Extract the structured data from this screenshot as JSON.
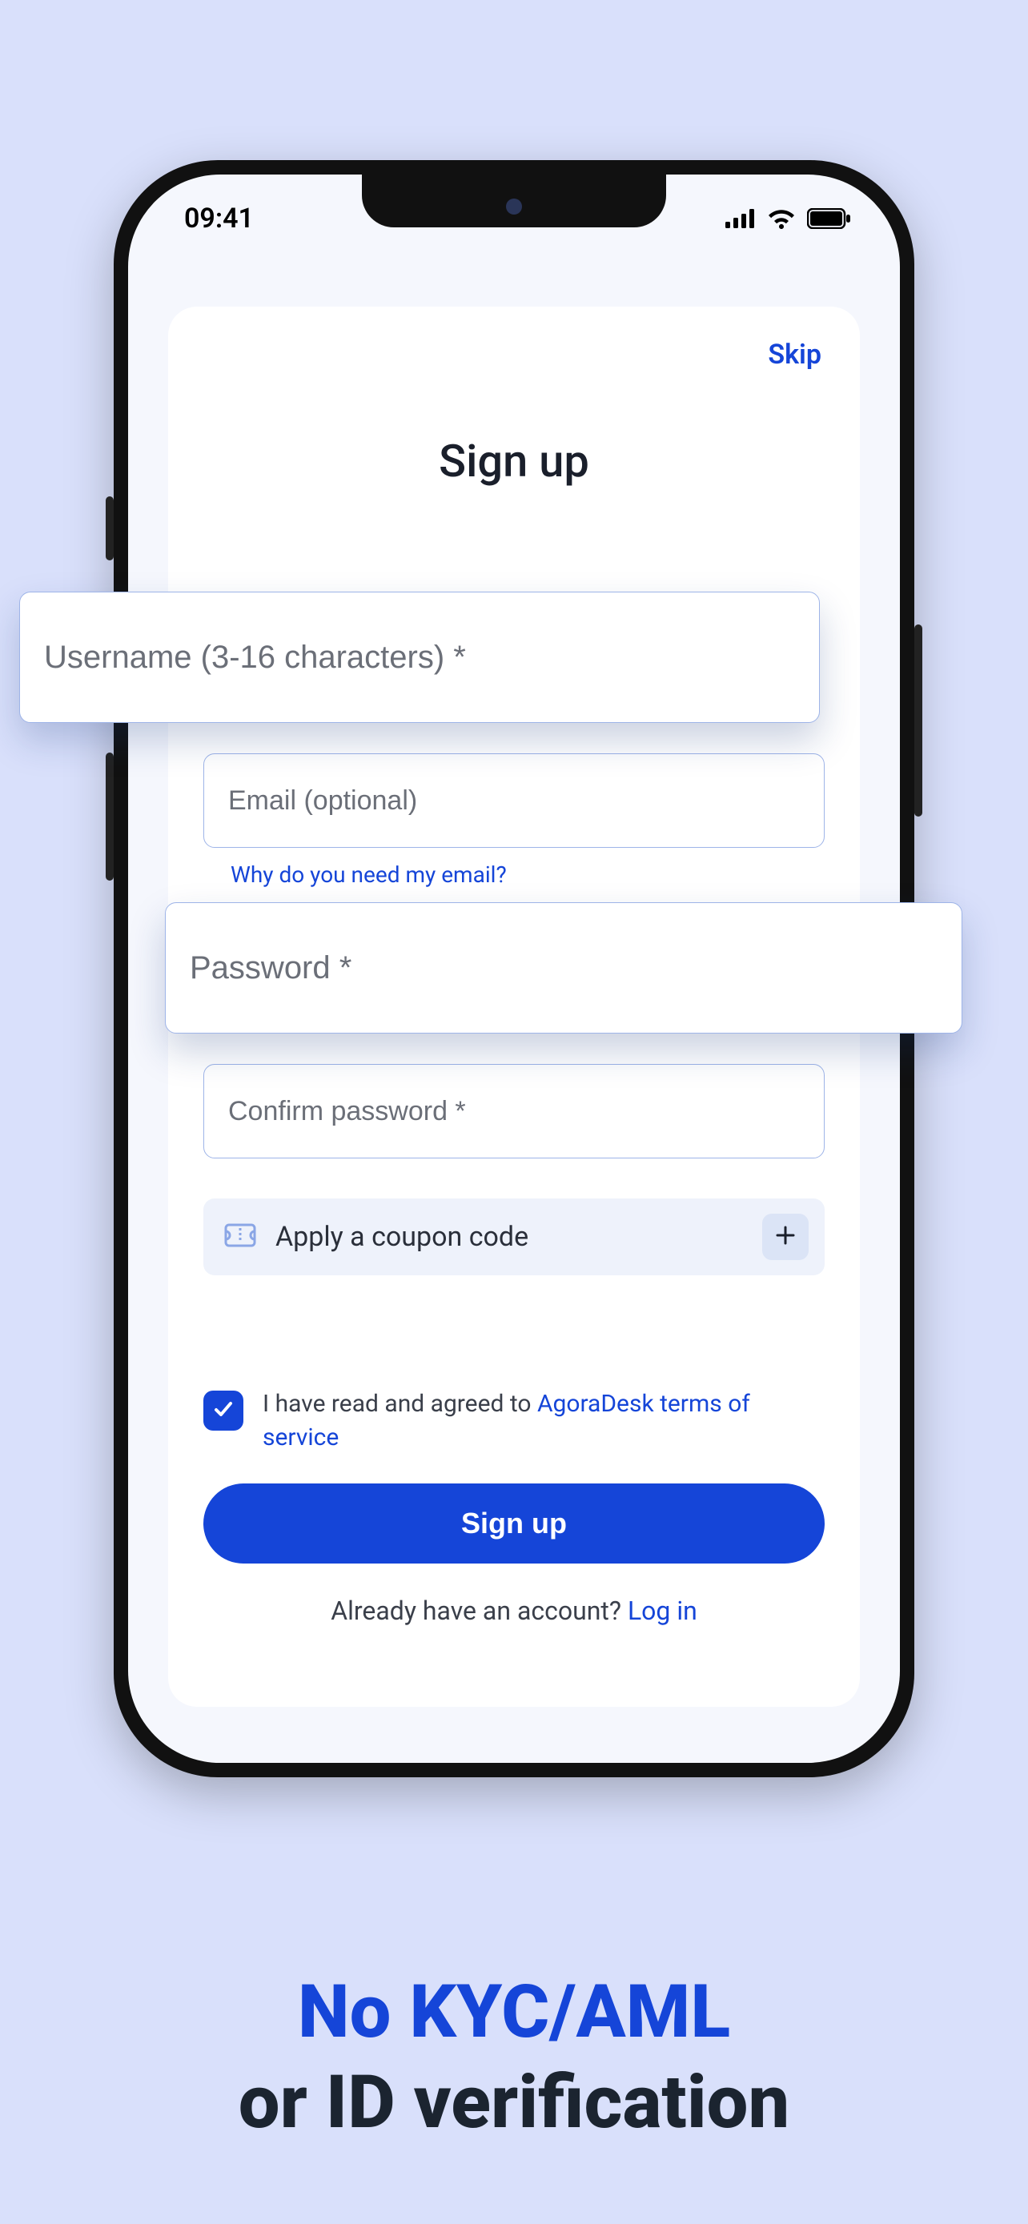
{
  "status": {
    "time": "09:41"
  },
  "card": {
    "skip_label": "Skip",
    "title": "Sign up",
    "fields": {
      "username_placeholder": "Username (3-16 characters) *",
      "email_placeholder": "Email (optional)",
      "email_hint": "Why do you need my email?",
      "password_placeholder": "Password *",
      "confirm_password_placeholder": "Confirm password *"
    },
    "coupon": {
      "label": "Apply a coupon code"
    },
    "terms": {
      "checked": true,
      "prefix": "I have read and agreed to ",
      "link_text": "AgoraDesk terms of service"
    },
    "submit_label": "Sign up",
    "already": {
      "prefix": "Already have an account? ",
      "login_label": "Log in"
    }
  },
  "marketing": {
    "line1": "No KYC/AML",
    "line2": "or ID verification"
  },
  "colors": {
    "accent": "#1545d8",
    "page_bg": "#d9e0fb"
  }
}
